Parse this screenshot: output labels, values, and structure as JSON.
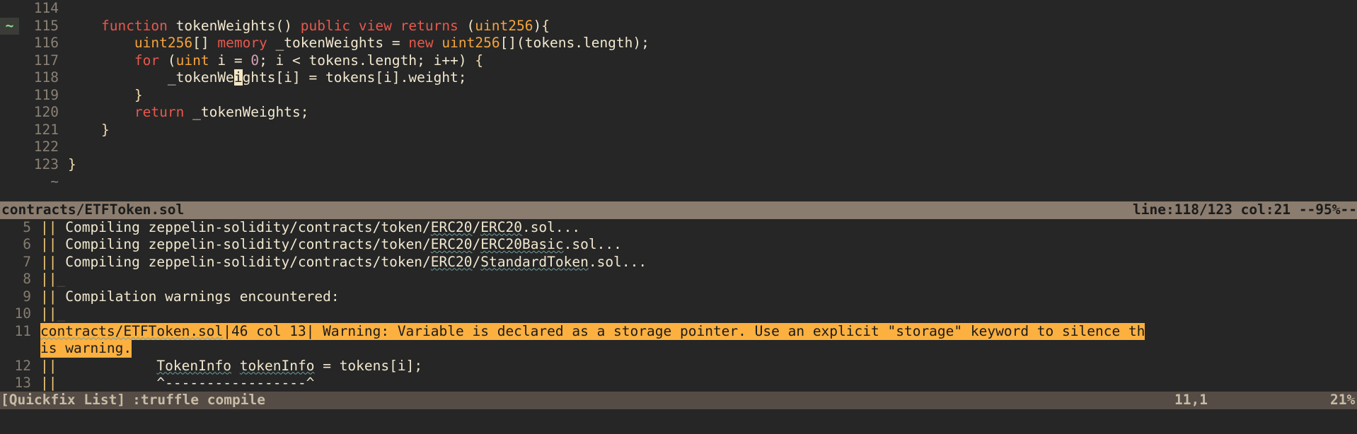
{
  "app": {
    "name": "vim",
    "theme_bg": "#262626"
  },
  "editor": {
    "filename": "contracts/ETFToken.sol",
    "status_right": "line:118/123 col:21 --95%--",
    "sign_marker": "~",
    "sign_marker_line": 115,
    "tilde": "~",
    "cursor": {
      "line": 118,
      "col": 21,
      "char": "i"
    },
    "lines": [
      {
        "num": "114",
        "text": ""
      },
      {
        "num": "115",
        "text": "    function tokenWeights() public view returns (uint256){"
      },
      {
        "num": "116",
        "text": "        uint256[] memory _tokenWeights = new uint256[](tokens.length);"
      },
      {
        "num": "117",
        "text": "        for (uint i = 0; i < tokens.length; i++) {"
      },
      {
        "num": "118",
        "text": "            _tokenWeights[i] = tokens[i].weight;"
      },
      {
        "num": "119",
        "text": "        }"
      },
      {
        "num": "120",
        "text": "        return _tokenWeights;"
      },
      {
        "num": "121",
        "text": "    }"
      },
      {
        "num": "122",
        "text": ""
      },
      {
        "num": "123",
        "text": "}"
      }
    ]
  },
  "quickfix": {
    "entries": [
      {
        "num": "5",
        "bars": "||",
        "text": "Compiling zeppelin-solidity/contracts/token/ERC20/ERC20.sol...",
        "highlight": false
      },
      {
        "num": "6",
        "bars": "||",
        "text": "Compiling zeppelin-solidity/contracts/token/ERC20/ERC20Basic.sol...",
        "highlight": false
      },
      {
        "num": "7",
        "bars": "||",
        "text": "Compiling zeppelin-solidity/contracts/token/ERC20/StandardToken.sol...",
        "highlight": false
      },
      {
        "num": "8",
        "bars": "||",
        "text": "",
        "highlight": false
      },
      {
        "num": "9",
        "bars": "||",
        "text": "Compilation warnings encountered:",
        "highlight": false
      },
      {
        "num": "10",
        "bars": "||",
        "text": "",
        "highlight": false
      },
      {
        "num": "11",
        "bars": "",
        "text": "contracts/ETFToken.sol|46 col 13| Warning: Variable is declared as a storage pointer. Use an explicit \"storage\" keyword to silence this warning.",
        "highlight": true
      },
      {
        "num": "12",
        "bars": "||",
        "text": "            TokenInfo tokenInfo = tokens[i];",
        "highlight": false
      },
      {
        "num": "13",
        "bars": "||",
        "text": "            ^-----------------^",
        "highlight": false
      }
    ],
    "warning": {
      "file": "contracts/ETFToken.sol",
      "location": "|46 col 13|",
      "message": " Warning: Variable is declared as a storage pointer. Use an explicit \"storage\" keyword to silence th",
      "message_wrap": "is warning.",
      "highlight_color": "#fbb040"
    }
  },
  "bottom_status": {
    "buffer_name": "[Quickfix List]",
    "command": ":truffle compile",
    "position": "11,1",
    "percent": "21%"
  }
}
